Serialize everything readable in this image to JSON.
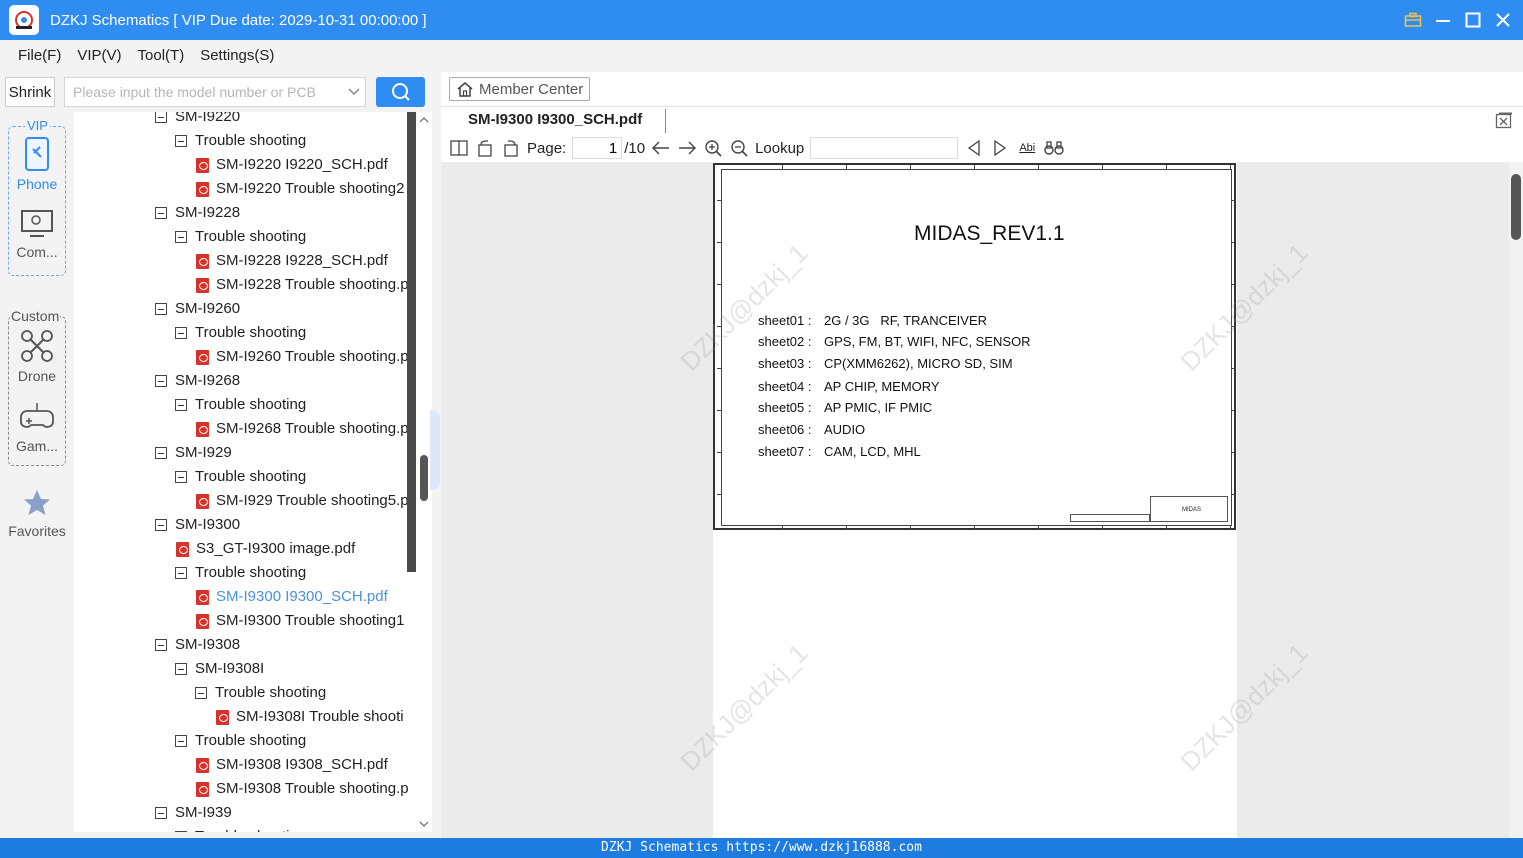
{
  "window": {
    "title": "DZKJ Schematics [ VIP Due date: 2029-10-31 00:00:00 ]"
  },
  "menu": {
    "items": [
      "File(F)",
      "VIP(V)",
      "Tool(T)",
      "Settings(S)"
    ]
  },
  "search": {
    "shrink_label": "Shrink",
    "placeholder": "Please input the model number or PCB"
  },
  "rail": {
    "vip_label": "VIP",
    "custom_label": "Custom",
    "phone": "Phone",
    "computer": "Com...",
    "drone": "Drone",
    "game": "Gam...",
    "favorites": "Favorites"
  },
  "tree": {
    "rows": [
      {
        "label": "SM-I9220",
        "kind": "folder",
        "level": 0
      },
      {
        "label": "Trouble shooting",
        "kind": "folder",
        "level": 1
      },
      {
        "label": "SM-I9220 I9220_SCH.pdf",
        "kind": "pdf",
        "level": 2
      },
      {
        "label": "SM-I9220 Trouble shooting2",
        "kind": "pdf",
        "level": 2
      },
      {
        "label": "SM-I9228",
        "kind": "folder",
        "level": 0
      },
      {
        "label": "Trouble shooting",
        "kind": "folder",
        "level": 1
      },
      {
        "label": "SM-I9228 I9228_SCH.pdf",
        "kind": "pdf",
        "level": 2
      },
      {
        "label": "SM-I9228 Trouble shooting.p",
        "kind": "pdf",
        "level": 2
      },
      {
        "label": "SM-I9260",
        "kind": "folder",
        "level": 0
      },
      {
        "label": "Trouble shooting",
        "kind": "folder",
        "level": 1
      },
      {
        "label": "SM-I9260 Trouble shooting.p",
        "kind": "pdf",
        "level": 2
      },
      {
        "label": "SM-I9268",
        "kind": "folder",
        "level": 0
      },
      {
        "label": "Trouble shooting",
        "kind": "folder",
        "level": 1
      },
      {
        "label": "SM-I9268 Trouble shooting.p",
        "kind": "pdf",
        "level": 2
      },
      {
        "label": "SM-I929",
        "kind": "folder",
        "level": 0
      },
      {
        "label": "Trouble shooting",
        "kind": "folder",
        "level": 1
      },
      {
        "label": "SM-I929 Trouble shooting5.p",
        "kind": "pdf",
        "level": 2
      },
      {
        "label": "SM-I9300",
        "kind": "folder",
        "level": 0
      },
      {
        "label": "S3_GT-I9300 image.pdf",
        "kind": "pdf",
        "level": 1
      },
      {
        "label": "Trouble shooting",
        "kind": "folder",
        "level": 1
      },
      {
        "label": "SM-I9300 I9300_SCH.pdf",
        "kind": "pdf",
        "level": 2,
        "selected": true
      },
      {
        "label": "SM-I9300 Trouble shooting1",
        "kind": "pdf",
        "level": 2
      },
      {
        "label": "SM-I9308",
        "kind": "folder",
        "level": 0
      },
      {
        "label": "SM-I9308I",
        "kind": "folder",
        "level": 1
      },
      {
        "label": "Trouble shooting",
        "kind": "folder",
        "level": 2
      },
      {
        "label": "SM-I9308I Trouble shooti",
        "kind": "pdf",
        "level": 3
      },
      {
        "label": "Trouble shooting",
        "kind": "folder",
        "level": 1
      },
      {
        "label": "SM-I9308 I9308_SCH.pdf",
        "kind": "pdf",
        "level": 2
      },
      {
        "label": "SM-I9308 Trouble shooting.p",
        "kind": "pdf",
        "level": 2
      },
      {
        "label": "SM-I939",
        "kind": "folder",
        "level": 0
      },
      {
        "label": "Trouble shooting",
        "kind": "folder",
        "level": 1
      }
    ]
  },
  "viewer": {
    "member_center": "Member Center",
    "tab_label": "SM-I9300 I9300_SCH.pdf",
    "page_label": "Page:",
    "page_value": "1",
    "page_total": "/10",
    "lookup_label": "Lookup",
    "abi_label": "Abi"
  },
  "sheet": {
    "title": "MIDAS_REV1.1",
    "lines": [
      {
        "k": "sheet01 :",
        "v": "2G / 3G   RF, TRANCEIVER"
      },
      {
        "k": "sheet02 :",
        "v": "GPS, FM, BT, WIFI, NFC, SENSOR"
      },
      {
        "k": "sheet03 :",
        "v": "CP(XMM6262), MICRO SD, SIM"
      },
      {
        "k": "sheet04 :",
        "v": "AP CHIP, MEMORY"
      },
      {
        "k": "sheet05 :",
        "v": "AP PMIC, IF PMIC"
      },
      {
        "k": "sheet06 :",
        "v": "AUDIO"
      },
      {
        "k": "sheet07 :",
        "v": "CAM, LCD, MHL"
      }
    ],
    "titleblock_text": "MIDAS",
    "watermark": "DZKJ@dzkj_1"
  },
  "status": {
    "text": "DZKJ Schematics https://www.dzkj16888.com"
  },
  "colors": {
    "accent": "#2f8cf0",
    "status_bar": "#1e7be0",
    "pdf_red": "#d8322c",
    "selected_text": "#4a90e2"
  }
}
